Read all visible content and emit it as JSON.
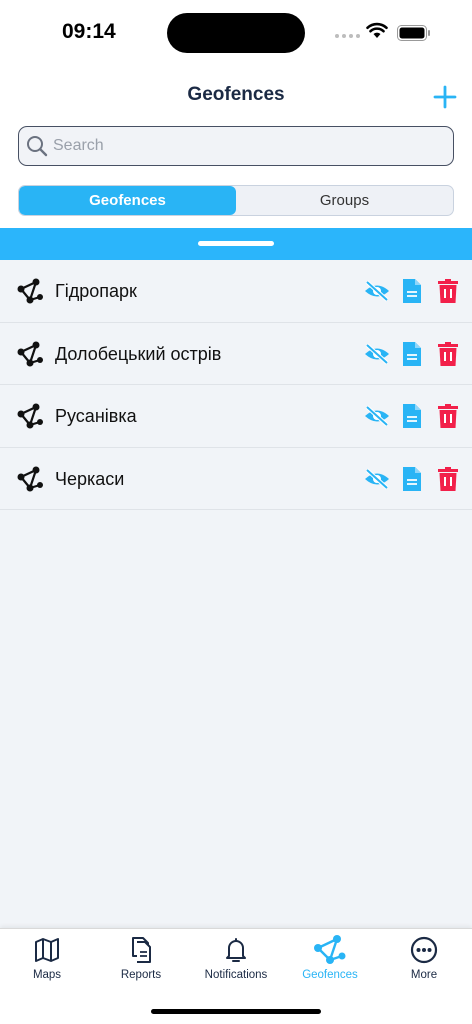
{
  "status": {
    "time": "09:14"
  },
  "header": {
    "title": "Geofences"
  },
  "search": {
    "placeholder": "Search",
    "value": ""
  },
  "segments": [
    {
      "label": "Geofences",
      "active": true
    },
    {
      "label": "Groups",
      "active": false
    }
  ],
  "geofences": [
    {
      "name": "Гідропарк"
    },
    {
      "name": "Долобецький острів"
    },
    {
      "name": "Русанівка"
    },
    {
      "name": "Черкаси"
    }
  ],
  "tabs": [
    {
      "label": "Maps",
      "icon": "map-icon"
    },
    {
      "label": "Reports",
      "icon": "reports-icon"
    },
    {
      "label": "Notifications",
      "icon": "bell-icon"
    },
    {
      "label": "Geofences",
      "icon": "geofence-icon",
      "active": true
    },
    {
      "label": "More",
      "icon": "more-icon"
    }
  ],
  "colors": {
    "accent": "#29b4f5",
    "band": "#2bb5fb",
    "delete": "#f2204a",
    "title": "#1b2a44"
  }
}
